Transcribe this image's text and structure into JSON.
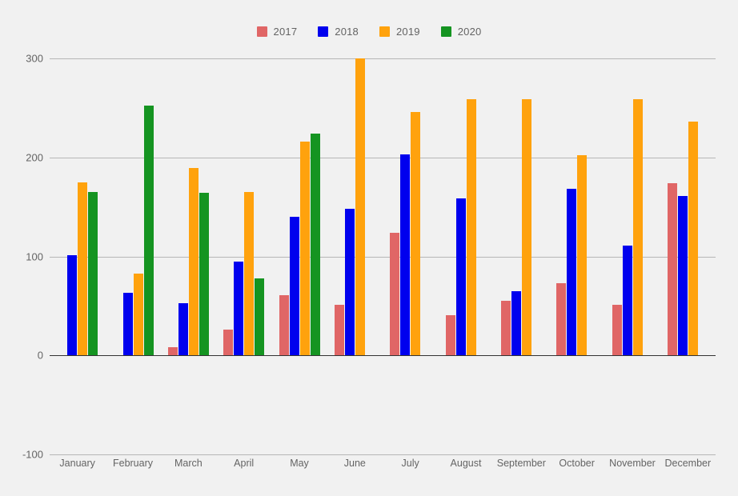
{
  "chart_data": {
    "type": "bar",
    "title": "",
    "xlabel": "",
    "ylabel": "",
    "ylim": [
      -100,
      300
    ],
    "yticks": [
      300,
      200,
      100,
      0,
      -100
    ],
    "ytick_labels": [
      "300",
      "200",
      "100",
      "0",
      "-100"
    ],
    "grid": true,
    "legend_position": "top-center",
    "categories": [
      "January",
      "February",
      "March",
      "April",
      "May",
      "June",
      "July",
      "August",
      "September",
      "October",
      "November",
      "December"
    ],
    "series": [
      {
        "name": "2017",
        "color": "#e06666",
        "values": [
          0,
          0,
          8,
          26,
          61,
          51,
          124,
          41,
          55,
          73,
          51,
          174
        ]
      },
      {
        "name": "2018",
        "color": "#0000ee",
        "values": [
          101,
          63,
          53,
          95,
          140,
          148,
          203,
          159,
          65,
          168,
          111,
          161
        ]
      },
      {
        "name": "2019",
        "color": "#ffa20d",
        "values": [
          175,
          83,
          189,
          165,
          216,
          300,
          246,
          259,
          259,
          202,
          259,
          236
        ]
      },
      {
        "name": "2020",
        "color": "#159421",
        "values": [
          165,
          252,
          164,
          78,
          224,
          0,
          0,
          0,
          0,
          0,
          0,
          0
        ]
      }
    ]
  },
  "legend": {
    "items": [
      {
        "label": "2017",
        "color": "#e06666"
      },
      {
        "label": "2018",
        "color": "#0000ee"
      },
      {
        "label": "2019",
        "color": "#ffa20d"
      },
      {
        "label": "2020",
        "color": "#159421"
      }
    ]
  },
  "colors": {
    "background": "#f1f1f1",
    "gridline": "#b7b7b7",
    "zero_line": "#333333",
    "tick_text": "#646464"
  }
}
